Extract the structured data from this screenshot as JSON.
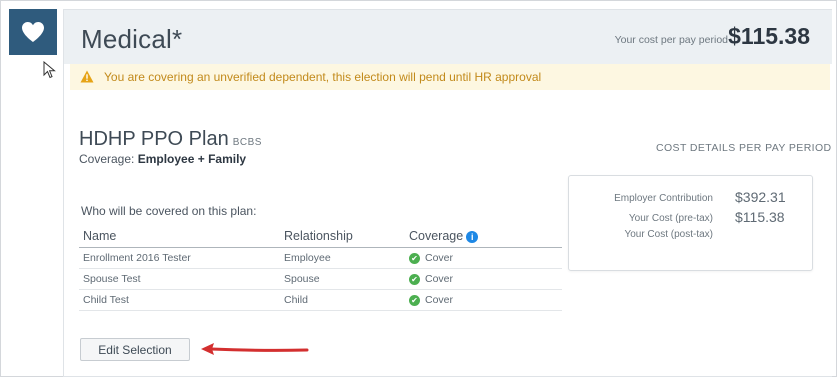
{
  "section": {
    "title": "Medical*",
    "cost_label": "Your cost per pay period",
    "cost_value": "$115.38"
  },
  "alert": {
    "text": "You are covering an unverified dependent, this election will pend until HR approval"
  },
  "plan": {
    "name": "HDHP PPO Plan",
    "carrier": "BCBS",
    "coverage_label": "Coverage:",
    "coverage_value": "Employee + Family"
  },
  "cost_details": {
    "heading": "COST DETAILS PER PAY PERIOD",
    "rows": [
      {
        "label": "Employer Contribution",
        "value": "$392.31"
      },
      {
        "label": "Your Cost (pre-tax)",
        "value": "$115.38"
      },
      {
        "label": "Your Cost (post-tax)",
        "value": ""
      }
    ]
  },
  "coverage_table": {
    "prompt": "Who will be covered on this plan:",
    "headers": [
      "Name",
      "Relationship",
      "Coverage"
    ],
    "rows": [
      {
        "name": "Enrollment 2016 Tester",
        "relationship": "Employee",
        "coverage": "Cover"
      },
      {
        "name": "Spouse Test",
        "relationship": "Spouse",
        "coverage": "Cover"
      },
      {
        "name": "Child Test",
        "relationship": "Child",
        "coverage": "Cover"
      }
    ]
  },
  "actions": {
    "edit_selection": "Edit Selection"
  },
  "colors": {
    "sidebar_tile": "#2f5b7d",
    "alert_bg": "#fdf7e1",
    "alert_text": "#c28a1b",
    "check_green": "#4caf50",
    "info_blue": "#1e88e5",
    "arrow_red": "#d32f2f"
  },
  "icons": [
    "heart-icon",
    "cursor-icon",
    "warning-icon",
    "info-icon",
    "check-icon",
    "arrow-icon"
  ]
}
